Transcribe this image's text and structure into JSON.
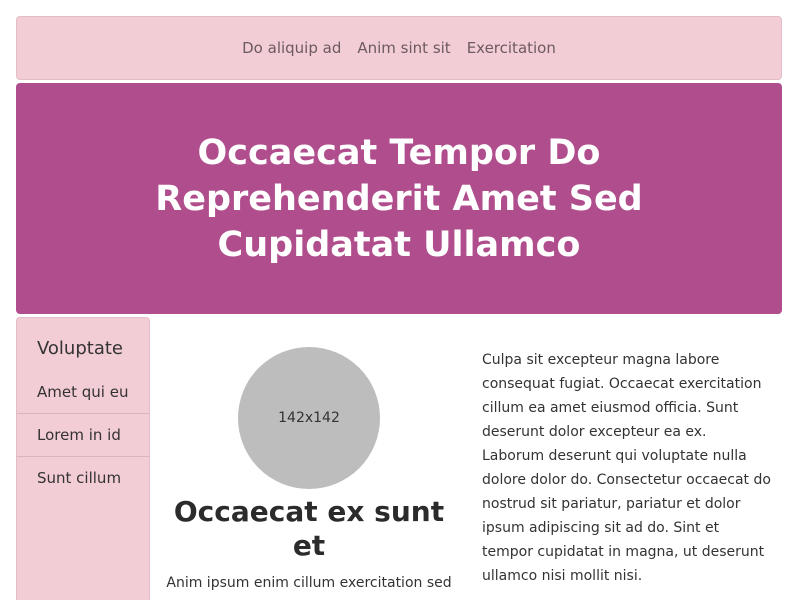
{
  "nav": {
    "links": [
      "Do aliquip ad",
      "Anim sint sit",
      "Exercitation"
    ]
  },
  "hero": {
    "title": "Occaecat Tempor Do Reprehenderit Amet Sed Cupidatat Ullamco"
  },
  "sidebar": {
    "title": "Voluptate",
    "items": [
      "Amet qui eu",
      "Lorem in id",
      "Sunt cillum"
    ]
  },
  "profile": {
    "avatar_label": "142x142",
    "heading": "Occaecat ex sunt et",
    "subtext": "Anim ipsum enim cillum exercitation sed dolor ut"
  },
  "body_text": "Culpa sit excepteur magna labore consequat fugiat. Occaecat exercitation cillum ea amet eiusmod officia. Sunt deserunt dolor excepteur ea ex. Laborum deserunt qui voluptate nulla dolore dolor do. Consectetur occaecat do nostrud sit pariatur, pariatur et dolor ipsum adipiscing sit ad do. Sint et tempor cupidatat in magna, ut deserunt ullamco nisi mollit nisi.",
  "colors": {
    "nav_bg": "#f3cdd6",
    "hero_bg": "#b04d8d",
    "avatar_bg": "#bdbdbd"
  }
}
